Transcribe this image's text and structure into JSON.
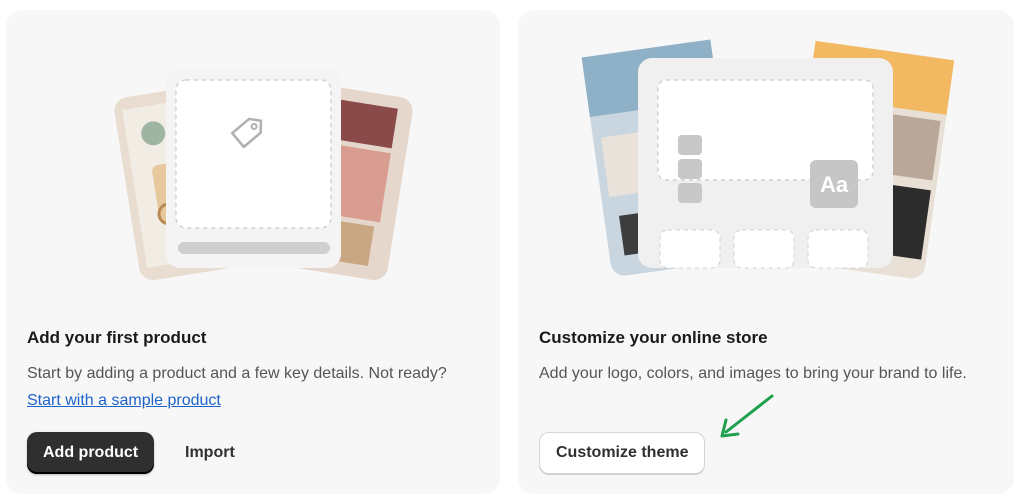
{
  "cards": [
    {
      "title": "Add your first product",
      "description_prefix": "Start by adding a product and a few key details. Not ready? ",
      "link_text": "Start with a sample product",
      "primary_button": "Add product",
      "secondary_button": "Import",
      "illustration_icon": "tag-icon"
    },
    {
      "title": "Customize your online store",
      "description": "Add your logo, colors, and images to bring your brand to life.",
      "button": "Customize theme",
      "illustration_text": "Aa"
    }
  ],
  "annotation": {
    "arrow_color": "#1fa04e"
  }
}
